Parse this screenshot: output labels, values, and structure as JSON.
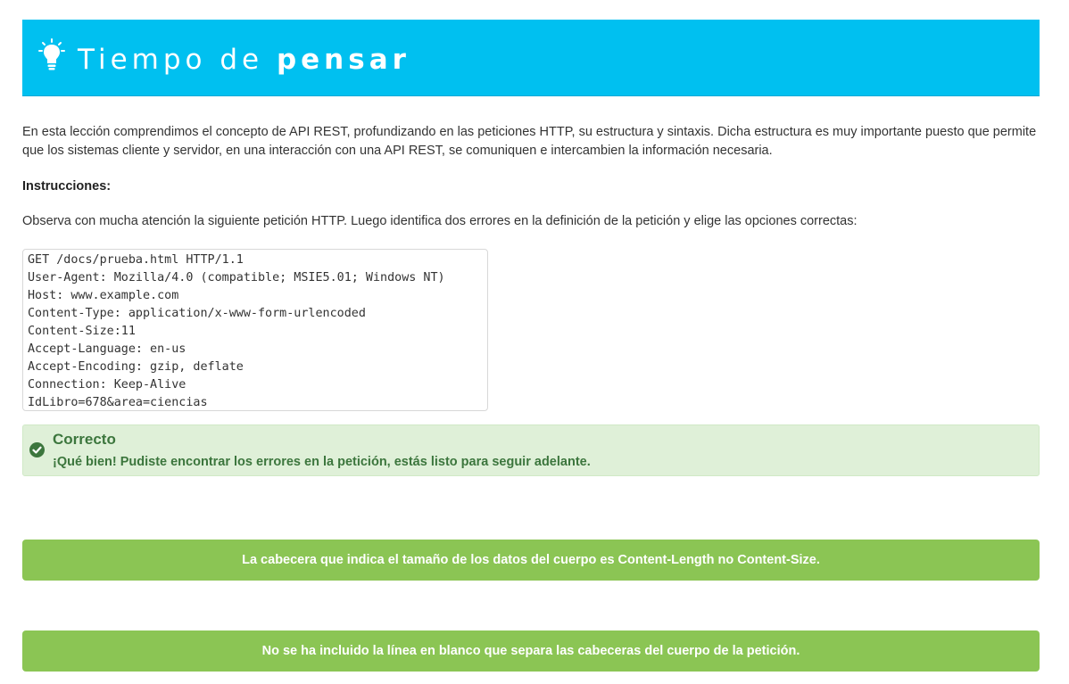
{
  "banner": {
    "title_light": "Tiempo de ",
    "title_bold": "pensar",
    "icon": "lightbulb-icon",
    "color": "#00c0f0"
  },
  "intro": {
    "text": "En esta lección comprendimos el concepto de API REST, profundizando en las peticiones HTTP, su estructura y sintaxis. Dicha estructura es muy importante puesto que permite que los sistemas cliente y servidor, en una interacción con una API REST, se comuniquen e intercambien la información necesaria."
  },
  "instructions": {
    "label": "Instrucciones:",
    "text": "Observa con mucha atención la siguiente petición HTTP. Luego identifica dos errores en la definición de la petición y elige las opciones correctas:"
  },
  "code": {
    "lines": [
      "GET /docs/prueba.html HTTP/1.1",
      "User-Agent: Mozilla/4.0 (compatible; MSIE5.01; Windows NT)",
      "Host: www.example.com",
      "Content-Type: application/x-www-form-urlencoded",
      "Content-Size:11",
      "Accept-Language: en-us",
      "Accept-Encoding: gzip, deflate",
      "Connection: Keep-Alive",
      "IdLibro=678&area=ciencias"
    ]
  },
  "feedback": {
    "title": "Correcto",
    "message": "¡Qué bien! Pudiste encontrar los errores en la petición, estás listo para seguir adelante.",
    "icon": "check-circle-icon",
    "color": "#3c763d",
    "background": "#dff0d8"
  },
  "options": [
    {
      "label": "La cabecera que indica el tamaño de los datos del cuerpo es Content-Length no Content-Size.",
      "color": "#8bc554"
    },
    {
      "label": "No se ha incluido la línea en blanco que separa las cabeceras del cuerpo de la petición.",
      "color": "#8bc554"
    }
  ]
}
